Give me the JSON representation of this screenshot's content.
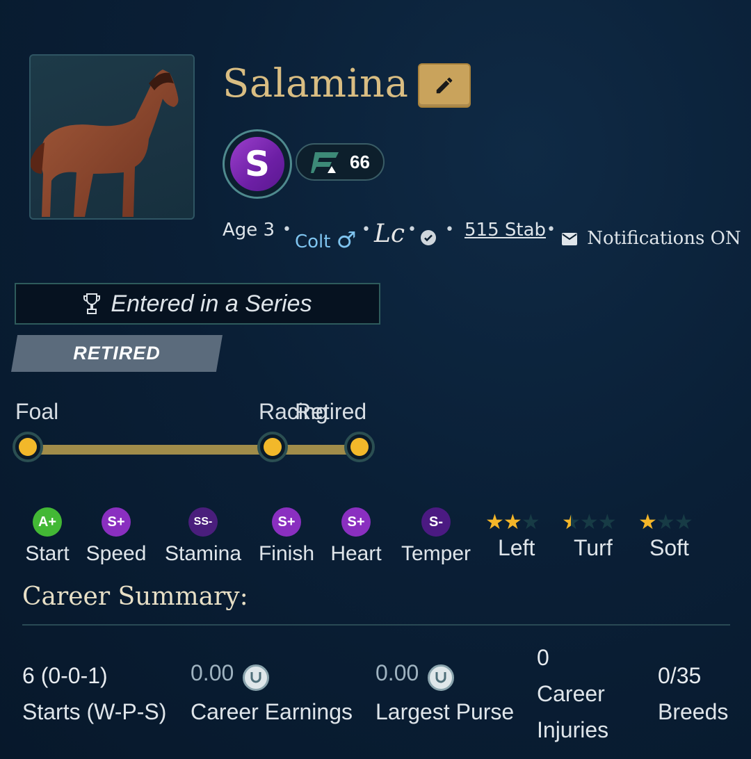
{
  "horse": {
    "name": "Salamina",
    "grade_letter": "S",
    "rating": "66",
    "portrait_icon": "horse-portrait"
  },
  "info": {
    "age": "Age 3",
    "sex": "Colt",
    "sex_symbol": "♂",
    "lc_mark": "Lc",
    "stable": "515 Stab",
    "notifications": "Notifications ON"
  },
  "series": {
    "label": "Entered in a Series"
  },
  "status_tag": "RETIRED",
  "timeline": {
    "foal": "Foal",
    "racing": "Racing",
    "retired": "Retired"
  },
  "stats": [
    {
      "grade": "A+",
      "label": "Start",
      "color": "#3fb53b"
    },
    {
      "grade": "S+",
      "label": "Speed",
      "color": "#8a2fc0"
    },
    {
      "grade": "SS-",
      "label": "Stamina",
      "color": "#4a1e7c"
    },
    {
      "grade": "S+",
      "label": "Finish",
      "color": "#8a2fc0"
    },
    {
      "grade": "S+",
      "label": "Heart",
      "color": "#8a2fc0"
    },
    {
      "grade": "S-",
      "label": "Temper",
      "color": "#4b1a82"
    }
  ],
  "preferences": [
    {
      "label": "Left",
      "stars": 2,
      "of": 3
    },
    {
      "label": "Turf",
      "stars": 0.5,
      "of": 3
    },
    {
      "label": "Soft",
      "stars": 1,
      "of": 3
    }
  ],
  "career": {
    "title": "Career Summary:",
    "starts_value": "6 (0-0-1)",
    "starts_label": "Starts (W-P-S)",
    "earnings_value": "0.00",
    "earnings_label": "Career Earnings",
    "purse_value": "0.00",
    "purse_label": "Largest Purse",
    "injuries_value": "0",
    "injuries_label_1": "Career",
    "injuries_label_2": "Injuries",
    "breeds_value": "0/35",
    "breeds_label": "Breeds"
  }
}
